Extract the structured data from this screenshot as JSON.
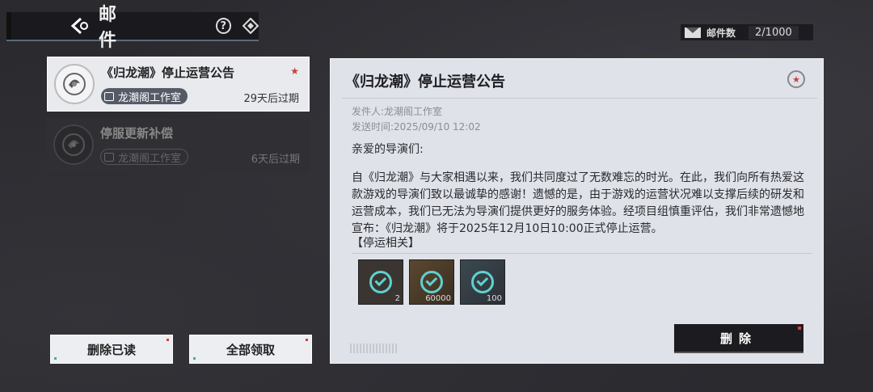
{
  "header": {
    "title": "邮件",
    "help_glyph": "?"
  },
  "mail_count": {
    "label": "邮件数",
    "value": "2/1000"
  },
  "mail_list": [
    {
      "title": "《归龙潮》停止运营公告",
      "sender": "龙潮阁工作室",
      "expiry": "29天后过期",
      "state": "selected",
      "starred": true
    },
    {
      "title": "停服更新补偿",
      "sender": "龙潮阁工作室",
      "expiry": "6天后过期",
      "state": "read",
      "starred": false
    }
  ],
  "buttons": {
    "delete_read": "删除已读",
    "claim_all": "全部领取",
    "delete": "删除"
  },
  "detail": {
    "title": "《归龙潮》停止运营公告",
    "sender_line": "发件人:龙潮阁工作室",
    "sent_line": "发送时间:2025/09/10 12:02",
    "greeting": "亲爱的导演们:",
    "body": "自《归龙潮》与大家相遇以来，我们共同度过了无数难忘的时光。在此，我们向所有热爱这款游戏的导演们致以最诚挚的感谢！遗憾的是，由于游戏的运营状况难以支撑后续的研发和运营成本，我们已无法为导演们提供更好的服务体验。经项目组慎重评估，我们非常遗憾地宣布：《归龙潮》将于2025年12月10日10:00正式停止运营。",
    "section": "【停运相关】",
    "attachments": [
      {
        "icon": "mystery-box-icon",
        "quantity": "2",
        "style": "dark"
      },
      {
        "icon": "currency-coin-icon",
        "quantity": "60000",
        "style": "gold"
      },
      {
        "icon": "crystal-icon",
        "quantity": "100",
        "style": "green"
      }
    ]
  },
  "colors": {
    "accent_red": "#c84040",
    "check_cyan": "#5fd0d0",
    "panel_bg": "#dfe2e8",
    "page_bg": "#2a2a2f"
  }
}
